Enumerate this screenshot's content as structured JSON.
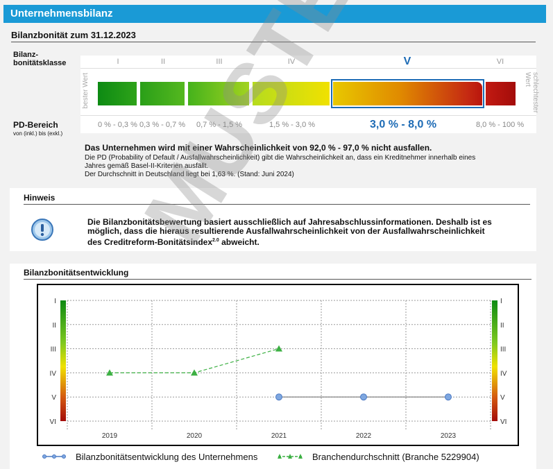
{
  "header": {
    "title": "Unternehmensbilanz"
  },
  "rating": {
    "title": "Bilanzbonität zum 31.12.2023",
    "class_label_1": "Bilanz-",
    "class_label_2": "bonitätsklasse",
    "classes": [
      "I",
      "II",
      "III",
      "IV",
      "V",
      "VI"
    ],
    "active_class": "V",
    "best_label": "bester Wert",
    "worst_label_1": "schlechtester",
    "worst_label_2": "Wert",
    "pd_label": "PD-Bereich",
    "pd_sublabel": "von (inkl.) bis (exkl.)",
    "pd_ranges": [
      "0 % - 0,3 %",
      "0,3 % - 0,7 %",
      "0,7 % - 1,5 %",
      "1,5 % - 3,0 %",
      "3,0 % - 8,0 %",
      "8,0 % - 100 %"
    ],
    "statement": "Das Unternehmen wird mit einer Wahrscheinlichkeit von 92,0 % - 97,0 % nicht ausfallen.",
    "explain_1": "Die PD (Probability of Default / Ausfallwahrscheinlichkeit) gibt die Wahrscheinlichkeit an, dass ein Kreditnehmer innerhalb eines",
    "explain_2": "Jahres gemäß Basel-II-Kriterien ausfällt.",
    "explain_3": "Der Durchschnitt in Deutschland liegt bei 1,63 %. (Stand: Juni 2024)"
  },
  "hint": {
    "title": "Hinweis",
    "line_1": "Die Bilanzbonitätsbewertung basiert ausschließlich auf Jahresabschlussinformationen. Deshalb ist es",
    "line_2": "möglich, dass die hieraus resultierende Ausfallwahrscheinlichkeit von der Ausfallwahrscheinlichkeit",
    "line_3_pre": "des Creditreform-Bonitätsindex",
    "line_3_sup": "2.0",
    "line_3_post": " abweicht."
  },
  "development": {
    "title": "Bilanzbonitätsentwicklung"
  },
  "chart_data": {
    "type": "line",
    "x": [
      "2019",
      "2020",
      "2021",
      "2022",
      "2023"
    ],
    "y_categories": [
      "I",
      "II",
      "III",
      "IV",
      "V",
      "VI"
    ],
    "grid": true,
    "legend": "bottom",
    "series": [
      {
        "name": "Bilanzbonitätsentwicklung des Unternehmens",
        "color": "#4a78c2",
        "values": [
          null,
          null,
          5,
          5,
          5
        ]
      },
      {
        "name": "Branchendurchschnitt (Branche 5229904)",
        "color": "#3cb043",
        "values": [
          4,
          4,
          3,
          null,
          null
        ]
      }
    ]
  },
  "watermark": "MUSTERCREFO",
  "colors": {
    "header": "#1a9ad6",
    "active": "#1d6bb5"
  }
}
